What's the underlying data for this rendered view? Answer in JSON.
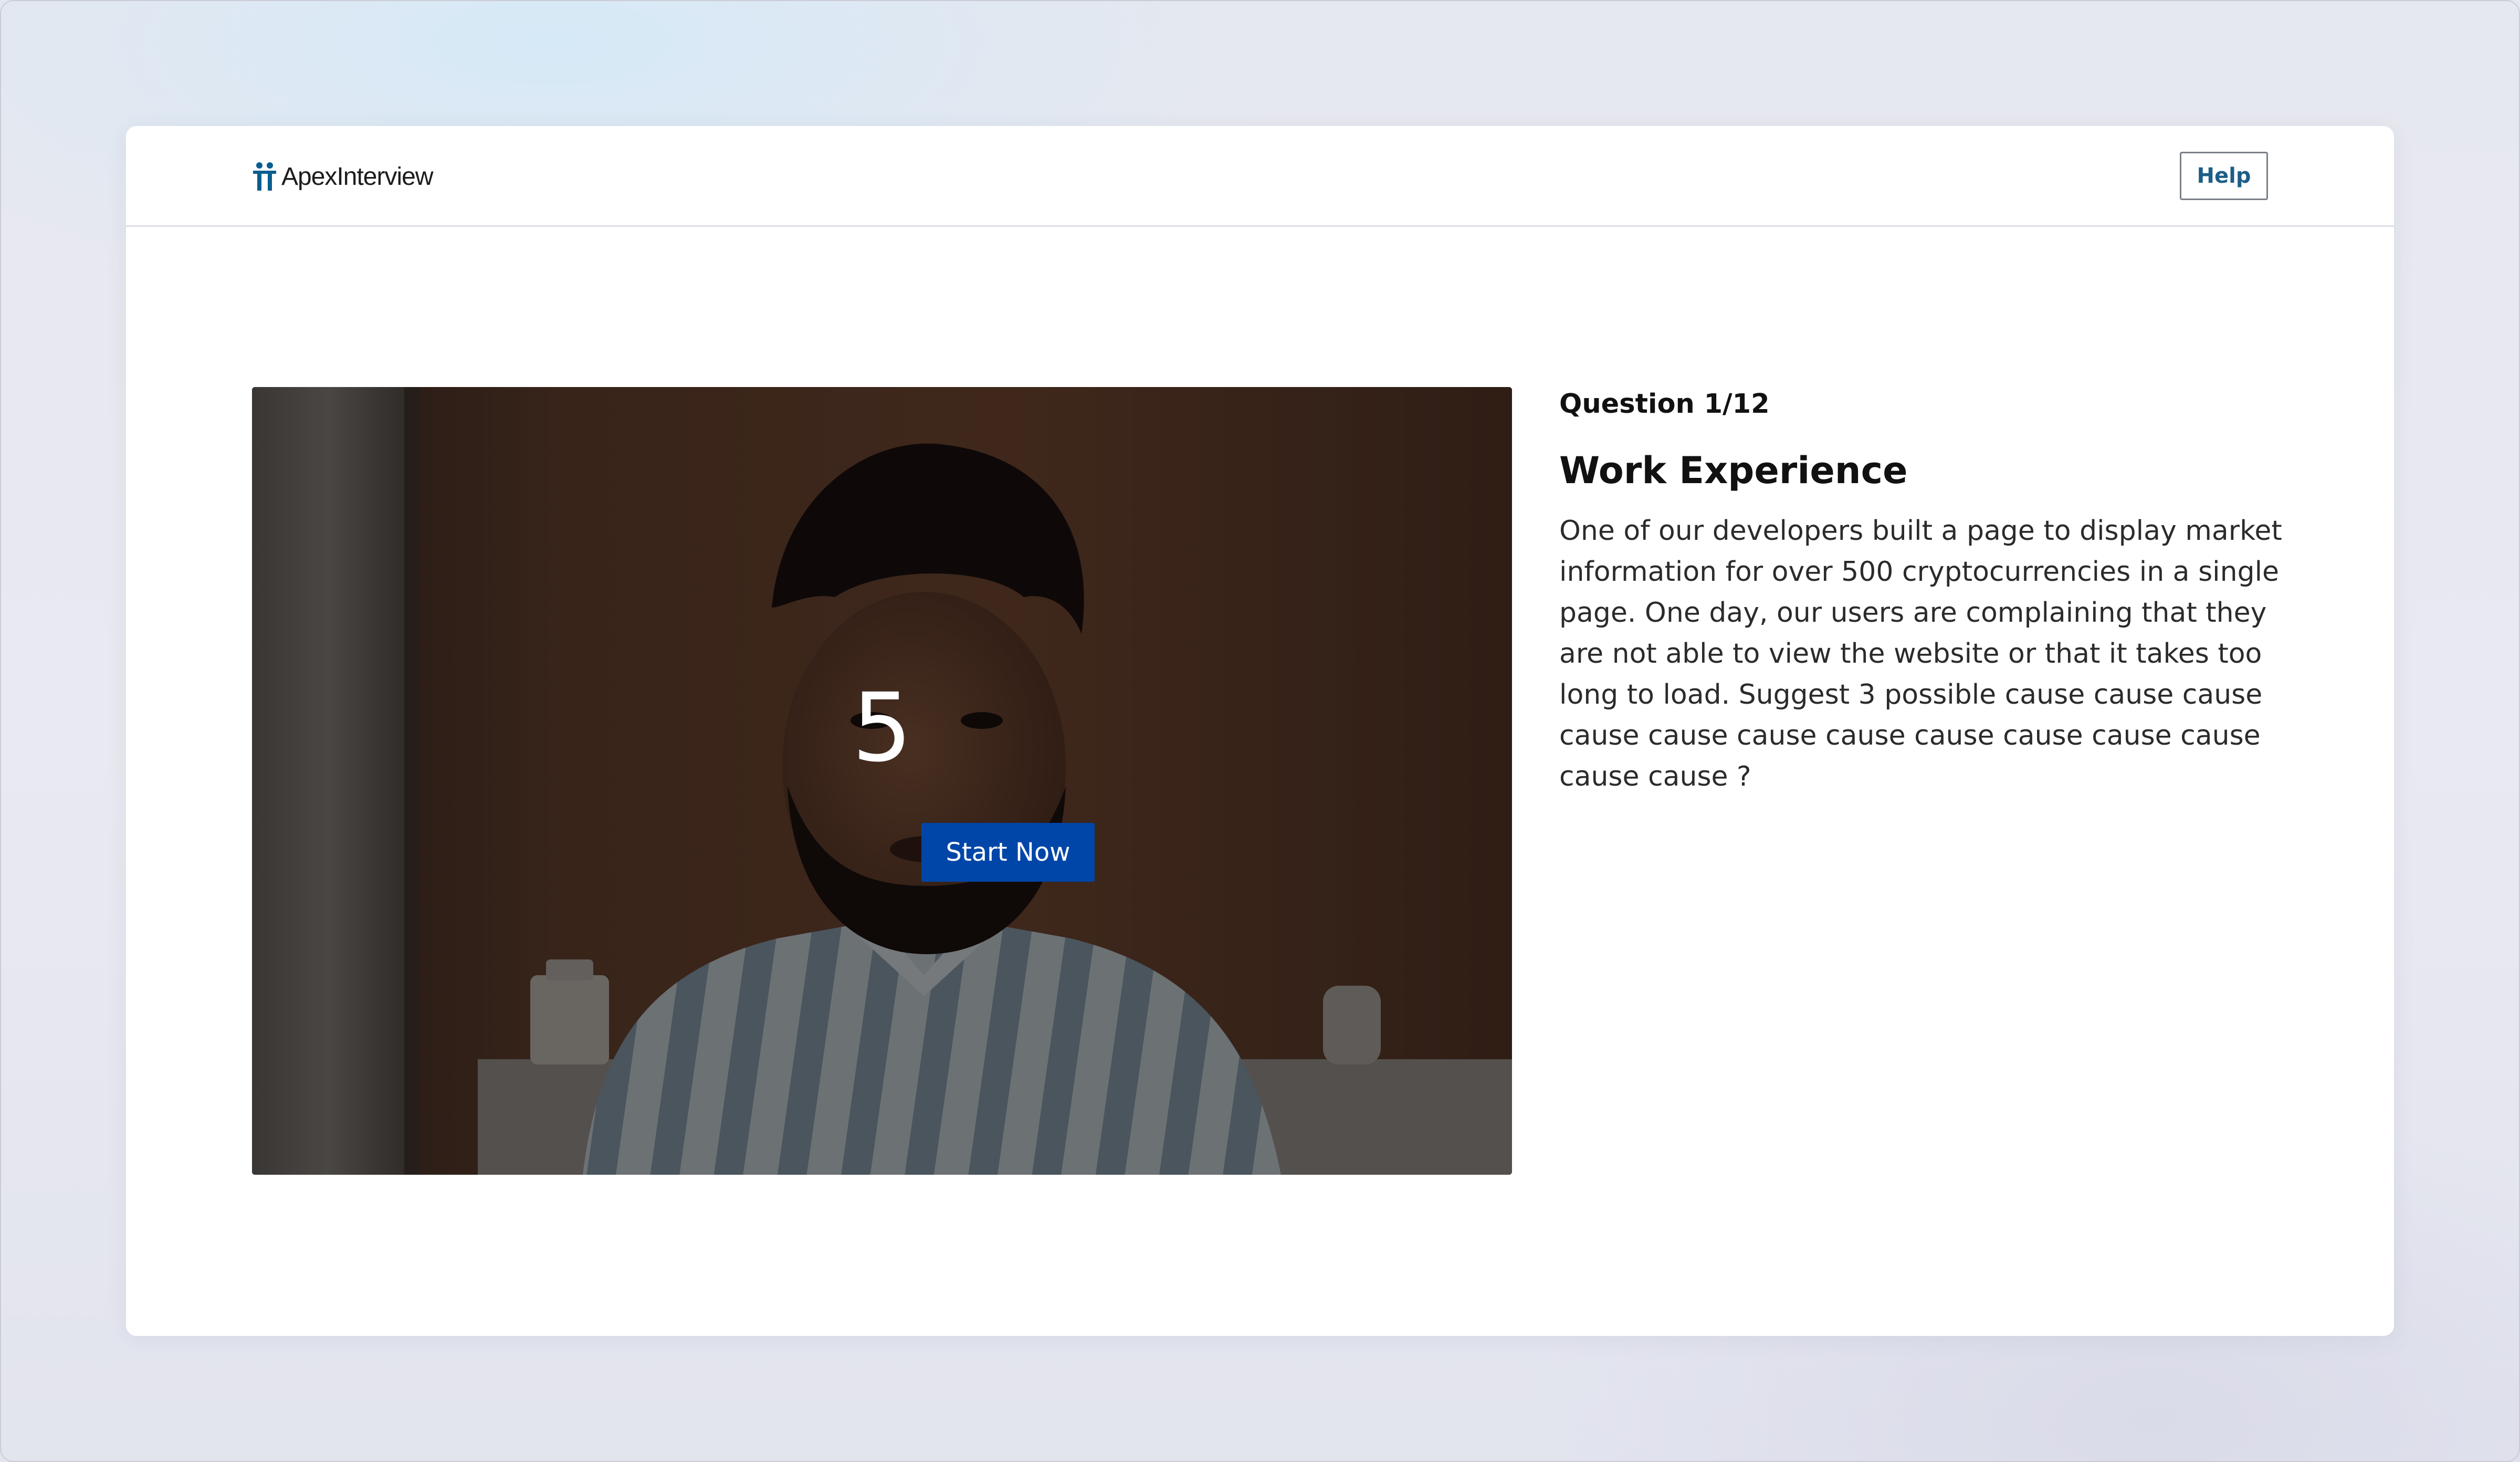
{
  "app": {
    "logo_text": "ApexInterview",
    "brand_color": "#0a5d8f"
  },
  "header": {
    "help_label": "Help"
  },
  "video": {
    "countdown": "5",
    "start_label": "Start Now",
    "start_button_color": "#0046a8"
  },
  "question": {
    "counter": "Question 1/12",
    "title": "Work Experience",
    "body": "One of our developers built a page to display market information for over 500 cryptocurrencies in a single page. One day, our users are complaining that they are not able to view the website or that it takes too long to load. Suggest 3 possible cause cause cause cause cause cause cause cause cause cause cause cause cause ?"
  }
}
